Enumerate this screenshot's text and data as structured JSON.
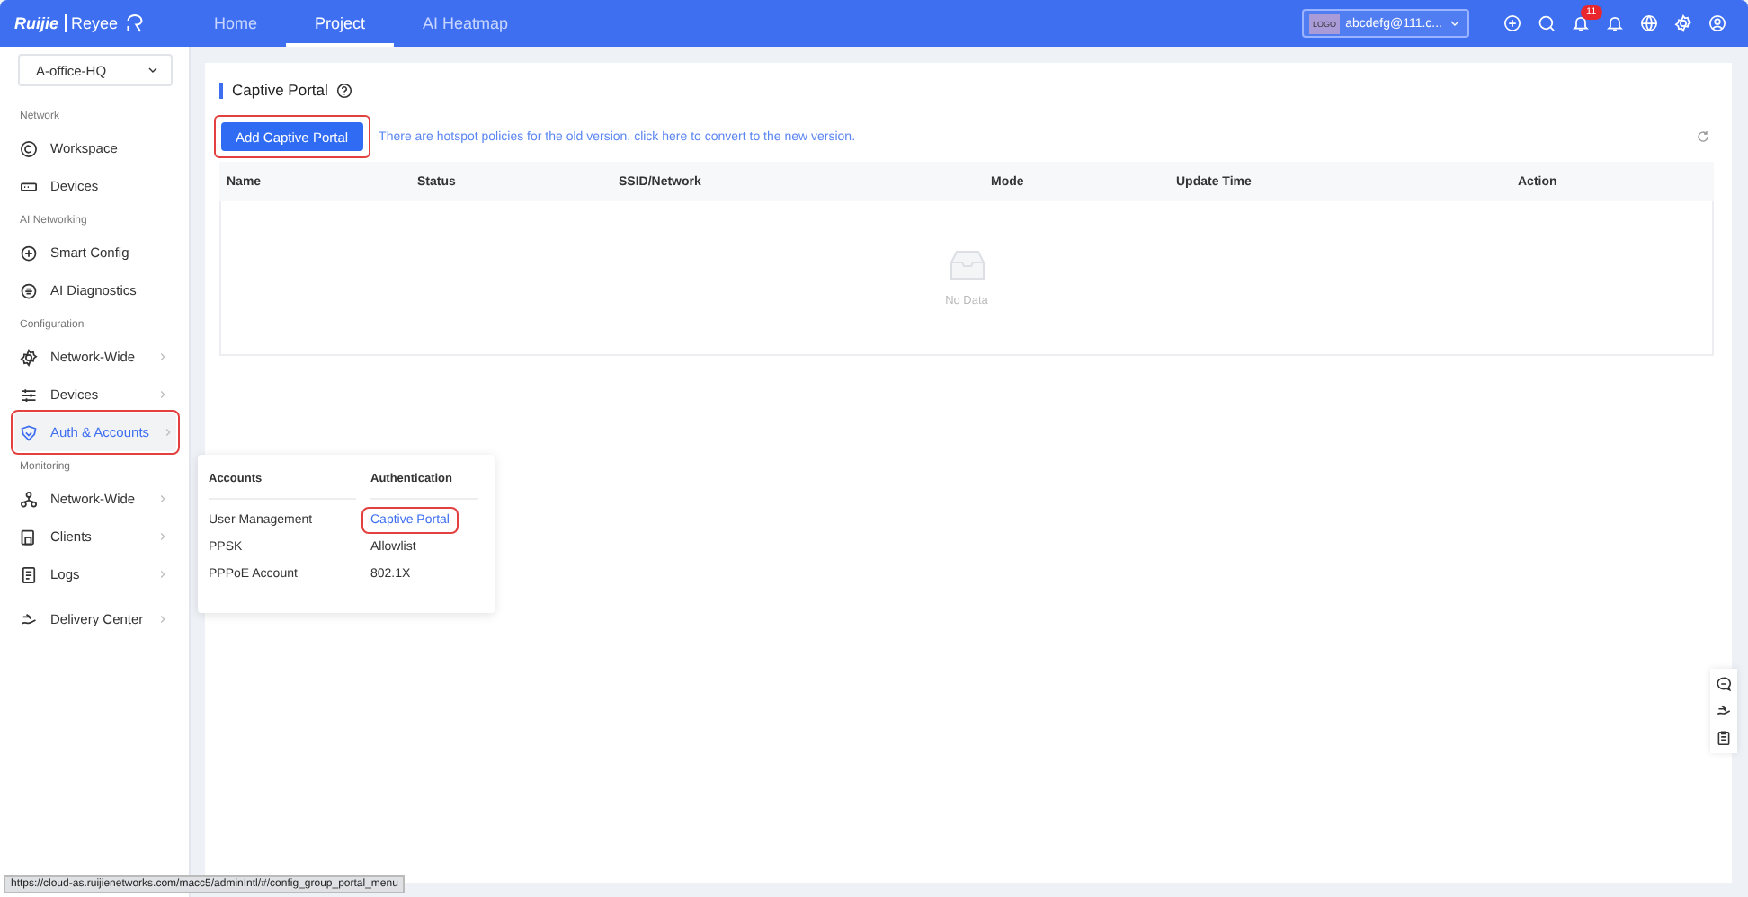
{
  "top_bar": {
    "logo": {
      "brand": "Ruijie",
      "product": "Reyee"
    },
    "tabs": [
      {
        "label": "Home",
        "selected": false
      },
      {
        "label": "Project",
        "selected": true
      },
      {
        "label": "AI Heatmap",
        "selected": false
      }
    ],
    "account": {
      "logo_text": "LOGO",
      "email": "abcdefg@111.c..."
    },
    "notification_badge": "11"
  },
  "sidebar": {
    "site_select": {
      "value": "A-office-HQ"
    },
    "sections": [
      {
        "title": "Network",
        "items": [
          {
            "label": "Workspace",
            "expandable": false,
            "selected": false,
            "annotated": false
          },
          {
            "label": "Devices",
            "expandable": false,
            "selected": false,
            "annotated": false
          }
        ]
      },
      {
        "title": "AI Networking",
        "items": [
          {
            "label": "Smart Config",
            "expandable": false,
            "selected": false,
            "annotated": false
          },
          {
            "label": "AI Diagnostics",
            "expandable": false,
            "selected": false,
            "annotated": false
          }
        ]
      },
      {
        "title": "Configuration",
        "items": [
          {
            "label": "Network-Wide",
            "expandable": true,
            "selected": false,
            "annotated": false
          },
          {
            "label": "Devices",
            "expandable": true,
            "selected": false,
            "annotated": false
          },
          {
            "label": "Auth & Accounts",
            "expandable": true,
            "selected": true,
            "annotated": true
          }
        ]
      },
      {
        "title": "Monitoring",
        "items": [
          {
            "label": "Network-Wide",
            "expandable": true,
            "selected": false,
            "annotated": false
          },
          {
            "label": "Clients",
            "expandable": true,
            "selected": false,
            "annotated": false
          },
          {
            "label": "Logs",
            "expandable": true,
            "selected": false,
            "annotated": false
          },
          {
            "label": "Delivery Center",
            "expandable": true,
            "selected": false,
            "annotated": false
          }
        ]
      }
    ]
  },
  "flyout_menu": {
    "columns": [
      {
        "title": "Accounts",
        "items": [
          {
            "label": "User Management",
            "selected": false,
            "annotated": false
          },
          {
            "label": "PPSK",
            "selected": false,
            "annotated": false
          },
          {
            "label": "PPPoE Account",
            "selected": false,
            "annotated": false
          }
        ]
      },
      {
        "title": "Authentication",
        "items": [
          {
            "label": "Captive Portal",
            "selected": true,
            "annotated": true
          },
          {
            "label": "Allowlist",
            "selected": false,
            "annotated": false
          },
          {
            "label": "802.1X",
            "selected": false,
            "annotated": false
          }
        ]
      }
    ]
  },
  "page": {
    "title": "Captive Portal",
    "add_button": {
      "label": "Add Captive Portal",
      "annotated": true
    },
    "notice": "There are hotspot policies for the old version, click here to convert to the new version.",
    "table": {
      "columns": [
        "Name",
        "Status",
        "SSID/Network",
        "Mode",
        "Update Time",
        "Action"
      ],
      "empty_text": "No Data"
    }
  },
  "status_bar": {
    "url": "https://cloud-as.ruijienetworks.com/macc5/adminIntl/#/config_group_portal_menu"
  }
}
